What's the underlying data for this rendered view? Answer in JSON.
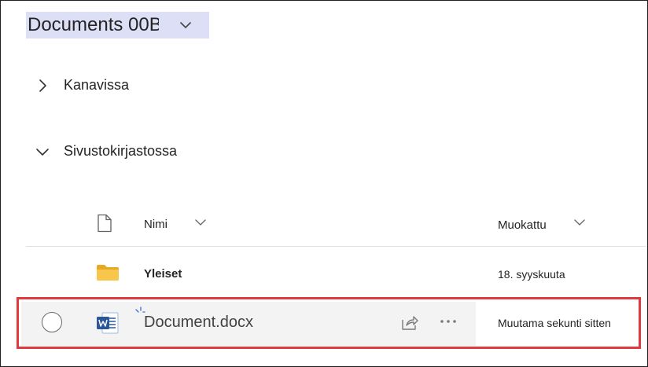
{
  "library": {
    "title": "Documents 00B"
  },
  "sections": [
    {
      "label": "Kanavissa",
      "expanded": false
    },
    {
      "label": "Sivustokirjastossa",
      "expanded": true
    }
  ],
  "columns": {
    "name": "Nimi",
    "modified": "Muokattu"
  },
  "rows": [
    {
      "name": "Yleiset",
      "type": "folder",
      "modified": "18. syyskuuta"
    },
    {
      "name": "Document.docx",
      "type": "word",
      "modified": "Muutama sekunti sitten",
      "highlighted": true
    }
  ],
  "colors": {
    "title_highlight": "#dcdff5",
    "folder": "#f7c64a",
    "word_blue": "#2b579a",
    "selection_border": "#e0393e",
    "row_bg": "#f3f3f3"
  }
}
